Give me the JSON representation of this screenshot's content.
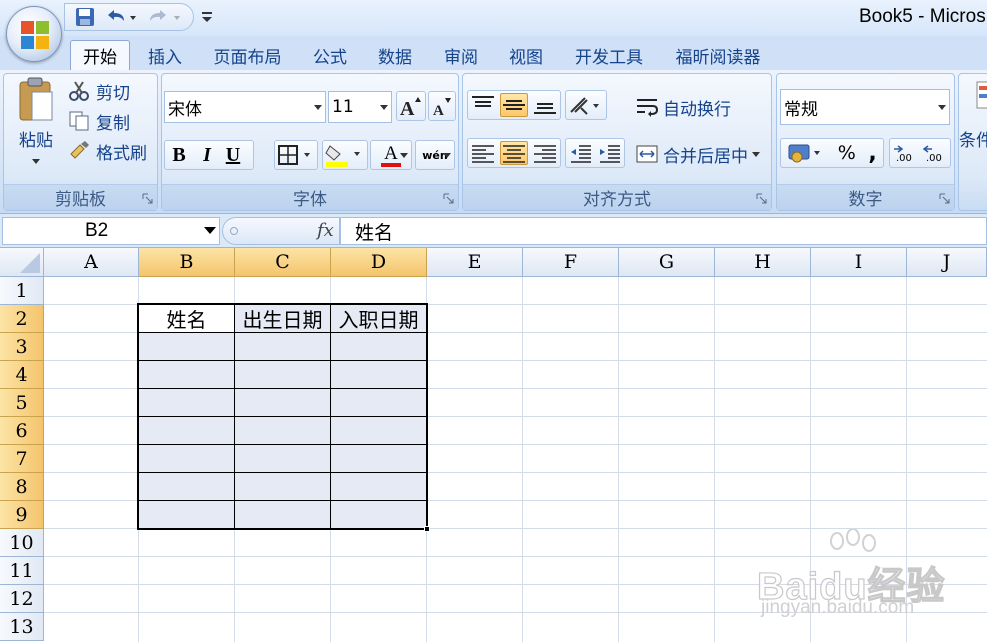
{
  "window": {
    "title": "Book5 - Micros"
  },
  "tabs": [
    {
      "label": "开始",
      "active": true
    },
    {
      "label": "插入"
    },
    {
      "label": "页面布局"
    },
    {
      "label": "公式"
    },
    {
      "label": "数据"
    },
    {
      "label": "审阅"
    },
    {
      "label": "视图"
    },
    {
      "label": "开发工具"
    },
    {
      "label": "福昕阅读器"
    }
  ],
  "ribbon": {
    "clipboard": {
      "label": "剪贴板",
      "paste": "粘贴",
      "cut": "剪切",
      "copy": "复制",
      "format_painter": "格式刷"
    },
    "font": {
      "label": "字体",
      "font_name": "宋体",
      "font_size": "11",
      "bold": "B",
      "italic": "I",
      "underline": "U",
      "font_color_glyph": "A",
      "phonetic_glyph": "wén"
    },
    "alignment": {
      "label": "对齐方式",
      "wrap_text": "自动换行",
      "merge_center": "合并后居中"
    },
    "number": {
      "label": "数字",
      "format": "常规",
      "percent": "%",
      "comma": ","
    },
    "styles": {
      "conditional": "条件"
    }
  },
  "formula_bar": {
    "name_box": "B2",
    "fx": "fx",
    "content": "姓名"
  },
  "grid": {
    "columns": [
      "A",
      "B",
      "C",
      "D",
      "E",
      "F",
      "G",
      "H",
      "I",
      "J"
    ],
    "selected_columns": [
      "B",
      "C",
      "D"
    ],
    "rows": [
      "1",
      "2",
      "3",
      "4",
      "5",
      "6",
      "7",
      "8",
      "9",
      "10",
      "11",
      "12",
      "13"
    ],
    "selected_rows": [
      "2",
      "3",
      "4",
      "5",
      "6",
      "7",
      "8",
      "9"
    ],
    "table_header": [
      "姓名",
      "出生日期",
      "入职日期"
    ]
  },
  "watermark": {
    "logo": "Baidu经验",
    "url": "jingyan.baidu.com"
  },
  "colors": {
    "ribbon": "#dde9f8",
    "selected_header": "#f4c46c",
    "selection_fill": "#e6eaf5"
  }
}
